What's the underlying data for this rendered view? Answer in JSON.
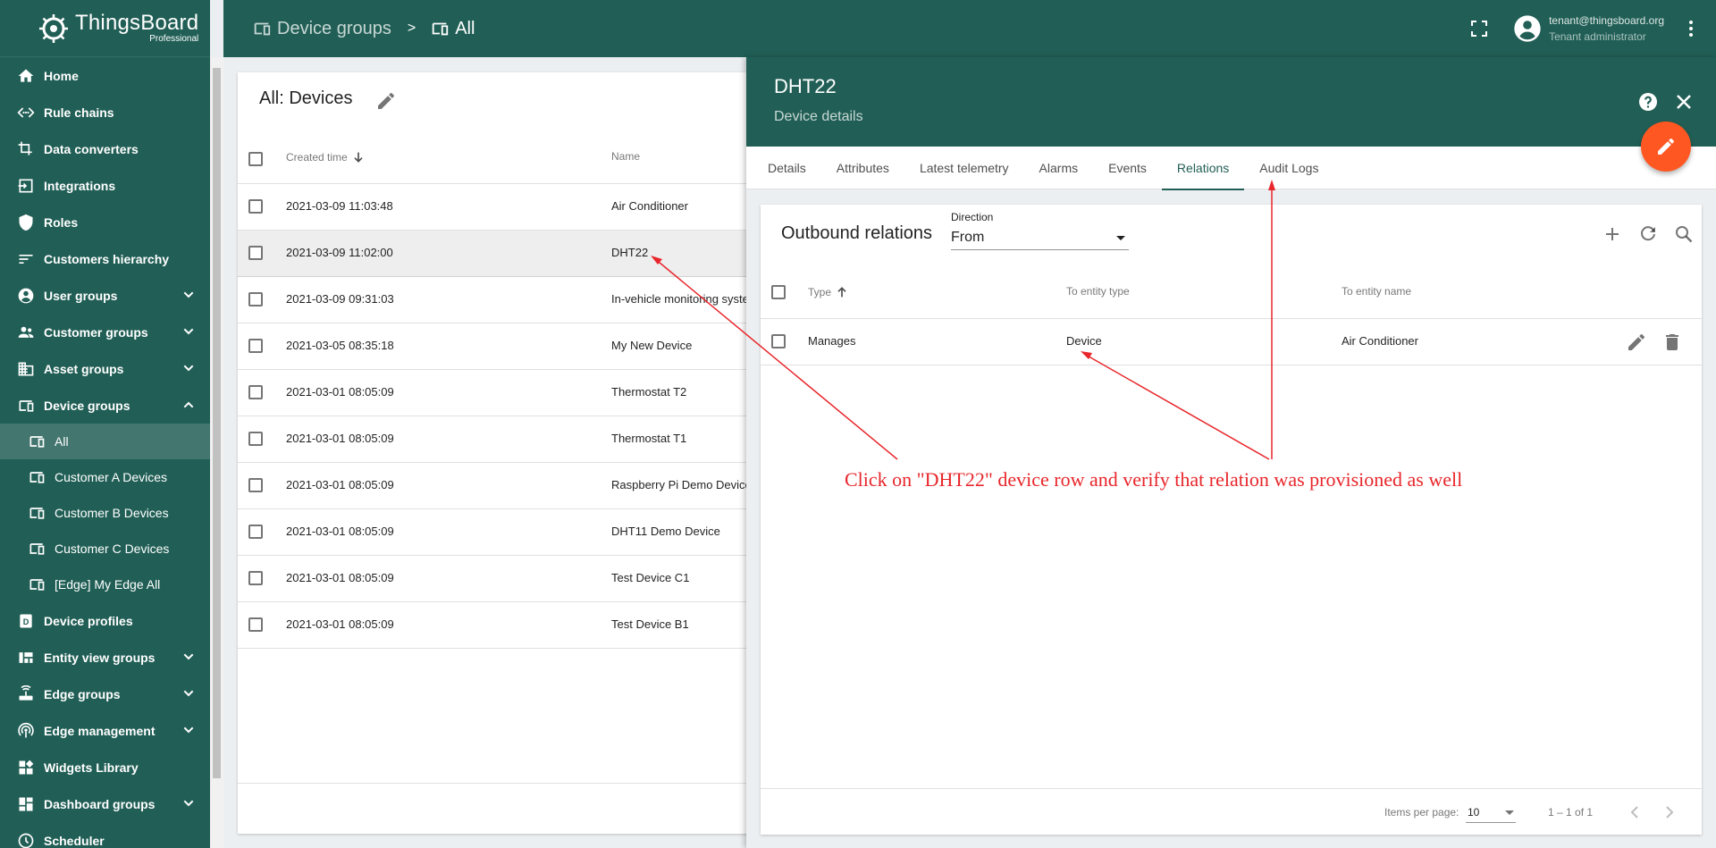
{
  "logo": {
    "title": "ThingsBoard",
    "subtitle": "Professional"
  },
  "sidebar": {
    "items": [
      {
        "label": "Home",
        "icon": "home-icon"
      },
      {
        "label": "Rule chains",
        "icon": "rule-chain-icon"
      },
      {
        "label": "Data converters",
        "icon": "transform-icon"
      },
      {
        "label": "Integrations",
        "icon": "input-icon"
      },
      {
        "label": "Roles",
        "icon": "shield-icon"
      },
      {
        "label": "Customers hierarchy",
        "icon": "sort-icon"
      },
      {
        "label": "User groups",
        "icon": "account-circle-icon"
      },
      {
        "label": "Customer groups",
        "icon": "supervisor-icon"
      },
      {
        "label": "Asset groups",
        "icon": "domain-icon"
      },
      {
        "label": "Device groups",
        "icon": "devices-icon"
      },
      {
        "label": "All",
        "icon": "devices-icon"
      },
      {
        "label": "Customer A Devices",
        "icon": "devices-icon"
      },
      {
        "label": "Customer B Devices",
        "icon": "devices-icon"
      },
      {
        "label": "Customer C Devices",
        "icon": "devices-icon"
      },
      {
        "label": "[Edge] My Edge All",
        "icon": "devices-icon"
      },
      {
        "label": "Device profiles",
        "icon": "device-profile-icon"
      },
      {
        "label": "Entity view groups",
        "icon": "view-quilt-icon"
      },
      {
        "label": "Edge groups",
        "icon": "router-icon"
      },
      {
        "label": "Edge management",
        "icon": "wifi-tethering-icon"
      },
      {
        "label": "Widgets Library",
        "icon": "widgets-icon"
      },
      {
        "label": "Dashboard groups",
        "icon": "dashboard-icon"
      },
      {
        "label": "Scheduler",
        "icon": "schedule-icon"
      }
    ]
  },
  "topbar": {
    "breadcrumb": [
      "Device groups",
      "All"
    ],
    "separator": ">",
    "user_email": "tenant@thingsboard.org",
    "user_role": "Tenant administrator"
  },
  "device_list": {
    "title": "All: Devices",
    "columns": {
      "created_time": "Created time",
      "name": "Name"
    },
    "rows": [
      {
        "created_time": "2021-03-09 11:03:48",
        "name": "Air Conditioner"
      },
      {
        "created_time": "2021-03-09 11:02:00",
        "name": "DHT22"
      },
      {
        "created_time": "2021-03-09 09:31:03",
        "name": "In-vehicle monitoring syste"
      },
      {
        "created_time": "2021-03-05 08:35:18",
        "name": "My New Device"
      },
      {
        "created_time": "2021-03-01 08:05:09",
        "name": "Thermostat T2"
      },
      {
        "created_time": "2021-03-01 08:05:09",
        "name": "Thermostat T1"
      },
      {
        "created_time": "2021-03-01 08:05:09",
        "name": "Raspberry Pi Demo Device"
      },
      {
        "created_time": "2021-03-01 08:05:09",
        "name": "DHT11 Demo Device"
      },
      {
        "created_time": "2021-03-01 08:05:09",
        "name": "Test Device C1"
      },
      {
        "created_time": "2021-03-01 08:05:09",
        "name": "Test Device B1"
      }
    ]
  },
  "details": {
    "title": "DHT22",
    "subtitle": "Device details",
    "tabs": [
      "Details",
      "Attributes",
      "Latest telemetry",
      "Alarms",
      "Events",
      "Relations",
      "Audit Logs"
    ],
    "relations": {
      "title": "Outbound relations",
      "direction_label": "Direction",
      "direction_value": "From",
      "columns": {
        "type": "Type",
        "to_entity_type": "To entity type",
        "to_entity_name": "To entity name"
      },
      "rows": [
        {
          "type": "Manages",
          "to_entity_type": "Device",
          "to_entity_name": "Air Conditioner"
        }
      ],
      "items_per_page_label": "Items per page:",
      "items_per_page": "10",
      "range": "1 – 1 of 1"
    }
  },
  "annotation": "Click on \"DHT22\" device row and verify that relation was provisioned as well",
  "colors": {
    "primary": "#215f56",
    "accent": "#ff5722",
    "annotation": "#e8262b"
  }
}
